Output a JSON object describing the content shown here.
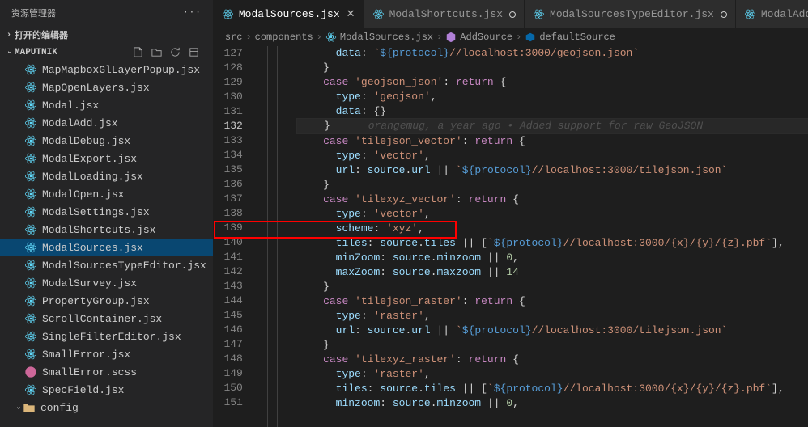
{
  "sidebar": {
    "title": "资源管理器",
    "open_editors": "打开的编辑器",
    "project": "MAPUTNIK",
    "files": [
      {
        "name": "MapMapboxGlLayerPopup.jsx",
        "type": "react"
      },
      {
        "name": "MapOpenLayers.jsx",
        "type": "react"
      },
      {
        "name": "Modal.jsx",
        "type": "react"
      },
      {
        "name": "ModalAdd.jsx",
        "type": "react"
      },
      {
        "name": "ModalDebug.jsx",
        "type": "react"
      },
      {
        "name": "ModalExport.jsx",
        "type": "react"
      },
      {
        "name": "ModalLoading.jsx",
        "type": "react"
      },
      {
        "name": "ModalOpen.jsx",
        "type": "react"
      },
      {
        "name": "ModalSettings.jsx",
        "type": "react"
      },
      {
        "name": "ModalShortcuts.jsx",
        "type": "react"
      },
      {
        "name": "ModalSources.jsx",
        "type": "react",
        "selected": true
      },
      {
        "name": "ModalSourcesTypeEditor.jsx",
        "type": "react"
      },
      {
        "name": "ModalSurvey.jsx",
        "type": "react"
      },
      {
        "name": "PropertyGroup.jsx",
        "type": "react"
      },
      {
        "name": "ScrollContainer.jsx",
        "type": "react"
      },
      {
        "name": "SingleFilterEditor.jsx",
        "type": "react"
      },
      {
        "name": "SmallError.jsx",
        "type": "react"
      },
      {
        "name": "SmallError.scss",
        "type": "sass"
      },
      {
        "name": "SpecField.jsx",
        "type": "react"
      }
    ],
    "folder": "config"
  },
  "tabs": [
    {
      "label": "ModalSources.jsx",
      "active": true,
      "close": true
    },
    {
      "label": "ModalShortcuts.jsx",
      "active": false,
      "dot": true
    },
    {
      "label": "ModalSourcesTypeEditor.jsx",
      "active": false,
      "dot": true
    },
    {
      "label": "ModalAdd.jsx",
      "active": false,
      "dot": true
    }
  ],
  "breadcrumb": {
    "items": [
      "src",
      "components",
      "ModalSources.jsx",
      "AddSource",
      "defaultSource"
    ]
  },
  "lines": {
    "start": 127,
    "end": 151
  },
  "code": {
    "l127": {
      "data": "data",
      "protocol": "${protocol}",
      "rest": "//localhost:3000/geojson.json"
    },
    "l129": {
      "case": "case",
      "val": "'geojson_json'",
      "ret": "return"
    },
    "l130": {
      "type": "type",
      "val": "'geojson'"
    },
    "l131": {
      "data": "data"
    },
    "l132": {
      "blame": "orangemug, a year ago • Added support for raw GeoJSON"
    },
    "l133": {
      "case": "case",
      "val": "'tilejson_vector'",
      "ret": "return"
    },
    "l134": {
      "type": "type",
      "val": "'vector'"
    },
    "l135": {
      "url": "url",
      "source": "source",
      "urlprop": "url",
      "protocol": "${protocol}",
      "rest": "//localhost:3000/tilejson.json"
    },
    "l137": {
      "case": "case",
      "val": "'tilexyz_vector'",
      "ret": "return"
    },
    "l138": {
      "type": "type",
      "val": "'vector'"
    },
    "l139": {
      "scheme": "scheme",
      "val": "'xyz'"
    },
    "l140": {
      "tiles": "tiles",
      "source": "source",
      "tilesprop": "tiles",
      "protocol": "${protocol}",
      "rest": "//localhost:3000/{x}/{y}/{z}.pbf"
    },
    "l141": {
      "minzoom": "minZoom",
      "source": "source",
      "prop": "minzoom",
      "val": "0"
    },
    "l142": {
      "maxzoom": "maxZoom",
      "source": "source",
      "prop": "maxzoom",
      "val": "14"
    },
    "l144": {
      "case": "case",
      "val": "'tilejson_raster'",
      "ret": "return"
    },
    "l145": {
      "type": "type",
      "val": "'raster'"
    },
    "l146": {
      "url": "url",
      "source": "source",
      "urlprop": "url",
      "protocol": "${protocol}",
      "rest": "//localhost:3000/tilejson.json"
    },
    "l148": {
      "case": "case",
      "val": "'tilexyz_raster'",
      "ret": "return"
    },
    "l149": {
      "type": "type",
      "val": "'raster'"
    },
    "l150": {
      "tiles": "tiles",
      "source": "source",
      "tilesprop": "tiles",
      "protocol": "${protocol}",
      "rest": "//localhost:3000/{x}/{y}/{z}.pbf"
    },
    "l151": {
      "minzoom": "minzoom",
      "source": "source",
      "prop": "minzoom",
      "val": "0"
    }
  }
}
